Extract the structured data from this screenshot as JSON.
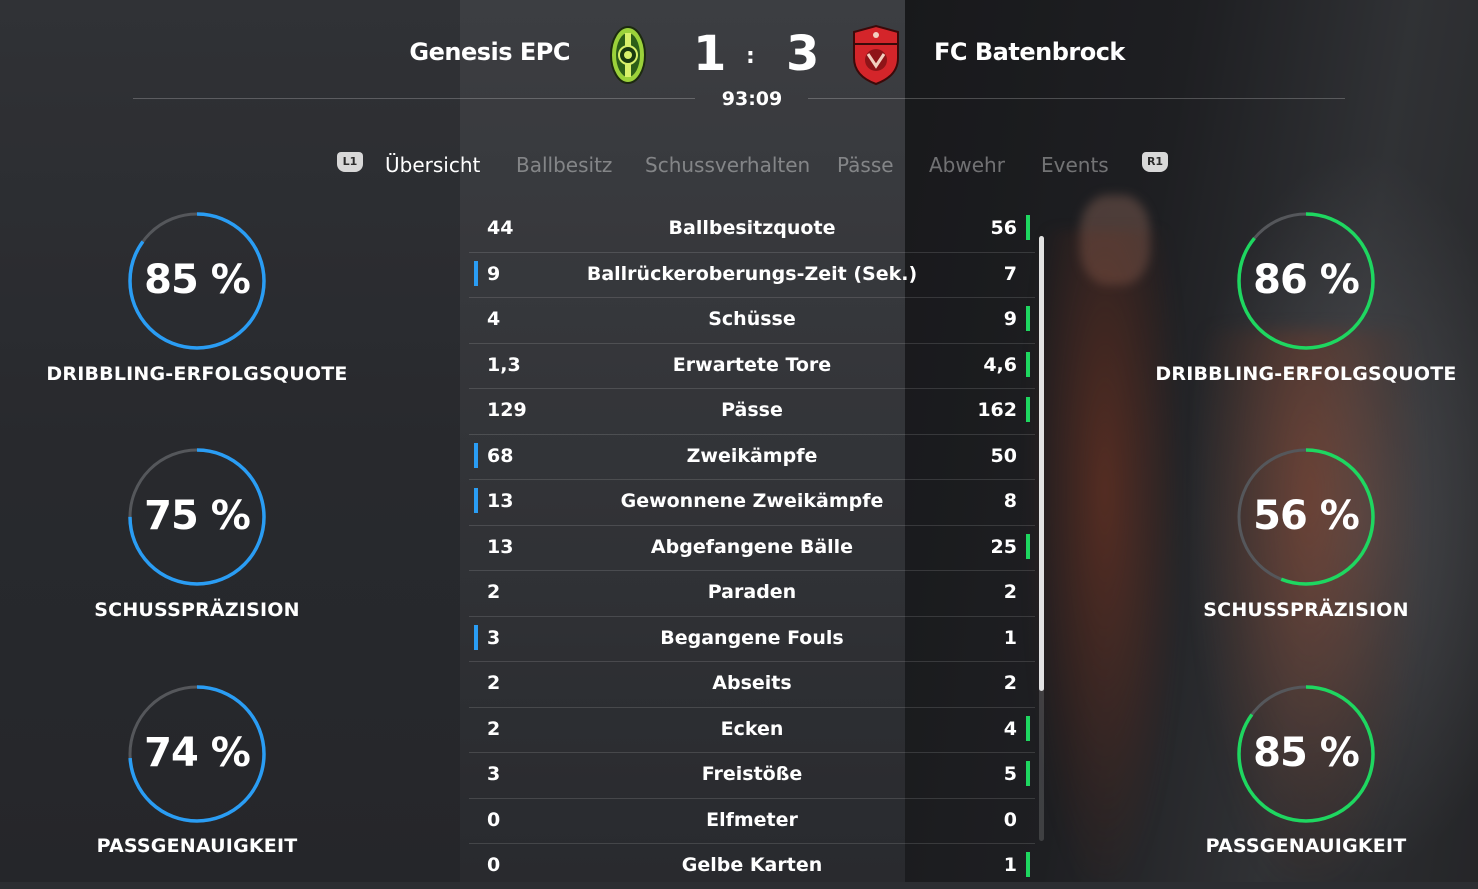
{
  "header": {
    "home_team": "Genesis EPC",
    "away_team": "FC Batenbrock",
    "home_score": "1",
    "away_score": "3",
    "separator": ":",
    "clock": "93:09"
  },
  "tabs": {
    "left_bumper": "L1",
    "right_bumper": "R1",
    "items": [
      {
        "label": "Übersicht",
        "active": true
      },
      {
        "label": "Ballbesitz",
        "active": false
      },
      {
        "label": "Schussverhalten",
        "active": false
      },
      {
        "label": "Pässe",
        "active": false
      },
      {
        "label": "Abwehr",
        "active": false
      },
      {
        "label": "Events",
        "active": false
      }
    ]
  },
  "home_rings": [
    {
      "percent_text": "85 %",
      "value": 85,
      "label": "DRIBBLING-ERFOLGSQUOTE"
    },
    {
      "percent_text": "75 %",
      "value": 75,
      "label": "SCHUSSPRÄZISION"
    },
    {
      "percent_text": "74 %",
      "value": 74,
      "label": "PASSGENAUIGKEIT"
    }
  ],
  "away_rings": [
    {
      "percent_text": "86 %",
      "value": 86,
      "label": "DRIBBLING-ERFOLGSQUOTE"
    },
    {
      "percent_text": "56 %",
      "value": 56,
      "label": "SCHUSSPRÄZISION"
    },
    {
      "percent_text": "85 %",
      "value": 85,
      "label": "PASSGENAUIGKEIT"
    }
  ],
  "colors": {
    "home_accent": "#2a9df4",
    "away_accent": "#1ed760",
    "ring_track": "#55575b"
  },
  "stats": [
    {
      "home": "44",
      "label": "Ballbesitzquote",
      "away": "56",
      "leader": "away"
    },
    {
      "home": "9",
      "label": "Ballrückeroberungs-Zeit (Sek.)",
      "away": "7",
      "leader": "home"
    },
    {
      "home": "4",
      "label": "Schüsse",
      "away": "9",
      "leader": "away"
    },
    {
      "home": "1,3",
      "label": "Erwartete Tore",
      "away": "4,6",
      "leader": "away"
    },
    {
      "home": "129",
      "label": "Pässe",
      "away": "162",
      "leader": "away"
    },
    {
      "home": "68",
      "label": "Zweikämpfe",
      "away": "50",
      "leader": "home"
    },
    {
      "home": "13",
      "label": "Gewonnene Zweikämpfe",
      "away": "8",
      "leader": "home"
    },
    {
      "home": "13",
      "label": "Abgefangene Bälle",
      "away": "25",
      "leader": "away"
    },
    {
      "home": "2",
      "label": "Paraden",
      "away": "2",
      "leader": "none"
    },
    {
      "home": "3",
      "label": "Begangene Fouls",
      "away": "1",
      "leader": "home"
    },
    {
      "home": "2",
      "label": "Abseits",
      "away": "2",
      "leader": "none"
    },
    {
      "home": "2",
      "label": "Ecken",
      "away": "4",
      "leader": "away"
    },
    {
      "home": "3",
      "label": "Freistöße",
      "away": "5",
      "leader": "away"
    },
    {
      "home": "0",
      "label": "Elfmeter",
      "away": "0",
      "leader": "none"
    },
    {
      "home": "0",
      "label": "Gelbe Karten",
      "away": "1",
      "leader": "away"
    }
  ],
  "icons": {
    "home_crest": "green-ring-crest-icon",
    "away_crest": "red-shield-crest-icon"
  }
}
